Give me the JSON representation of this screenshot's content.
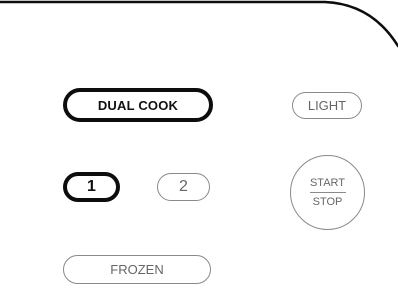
{
  "panel": {
    "buttons": {
      "dual_cook": "DUAL COOK",
      "light": "LIGHT",
      "rack_1": "1",
      "rack_2": "2",
      "start": "START",
      "stop": "STOP",
      "frozen": "FROZEN"
    },
    "selected": [
      "DUAL COOK",
      "1"
    ],
    "colors": {
      "selected_outline": "#0d0d0d",
      "unselected_outline": "#8a8a8a",
      "unselected_text": "#666666",
      "panel_edge": "#0d0d0d"
    }
  }
}
